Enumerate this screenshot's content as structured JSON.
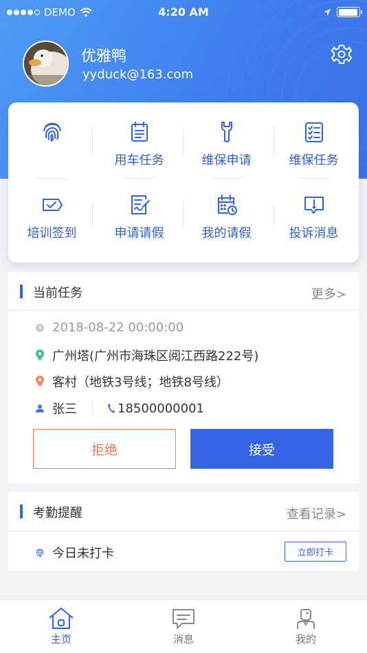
{
  "status_bar": {
    "carrier": "DEMO",
    "time": "4:20 AM",
    "battery_level": 0.95
  },
  "profile": {
    "name": "优雅鸭",
    "email": "yyduck@163.com"
  },
  "menu": {
    "items": [
      {
        "label": "",
        "icon": "fingerprint-icon"
      },
      {
        "label": "用车任务",
        "icon": "calendar-list-icon"
      },
      {
        "label": "维保申请",
        "icon": "wrench-icon"
      },
      {
        "label": "维保任务",
        "icon": "checklist-icon"
      },
      {
        "label": "培训签到",
        "icon": "ticket-check-icon"
      },
      {
        "label": "申请请假",
        "icon": "edit-document-icon"
      },
      {
        "label": "我的请假",
        "icon": "calendar-clock-icon"
      },
      {
        "label": "投诉消息",
        "icon": "alert-message-icon"
      }
    ]
  },
  "current_task": {
    "title": "当前任务",
    "more": "更多>",
    "datetime": "2018-08-22  00:00:00",
    "origin": "广州塔(广州市海珠区阅江西路222号)",
    "destination": "客村（地铁3号线；地铁8号线）",
    "contact_name": "张三",
    "contact_phone": "18500000001",
    "reject_label": "拒绝",
    "accept_label": "接受"
  },
  "attendance": {
    "title": "考勤提醒",
    "more": "查看记录>",
    "status": "今日未打卡",
    "punch_label": "立即打卡"
  },
  "tabbar": {
    "tabs": [
      {
        "label": "主页",
        "icon": "home-icon",
        "active": true
      },
      {
        "label": "消息",
        "icon": "message-icon",
        "active": false
      },
      {
        "label": "我的",
        "icon": "user-icon",
        "active": false
      }
    ]
  },
  "colors": {
    "primary": "#3565e6",
    "reject": "#f0774f",
    "header": "#4a8ff3"
  }
}
